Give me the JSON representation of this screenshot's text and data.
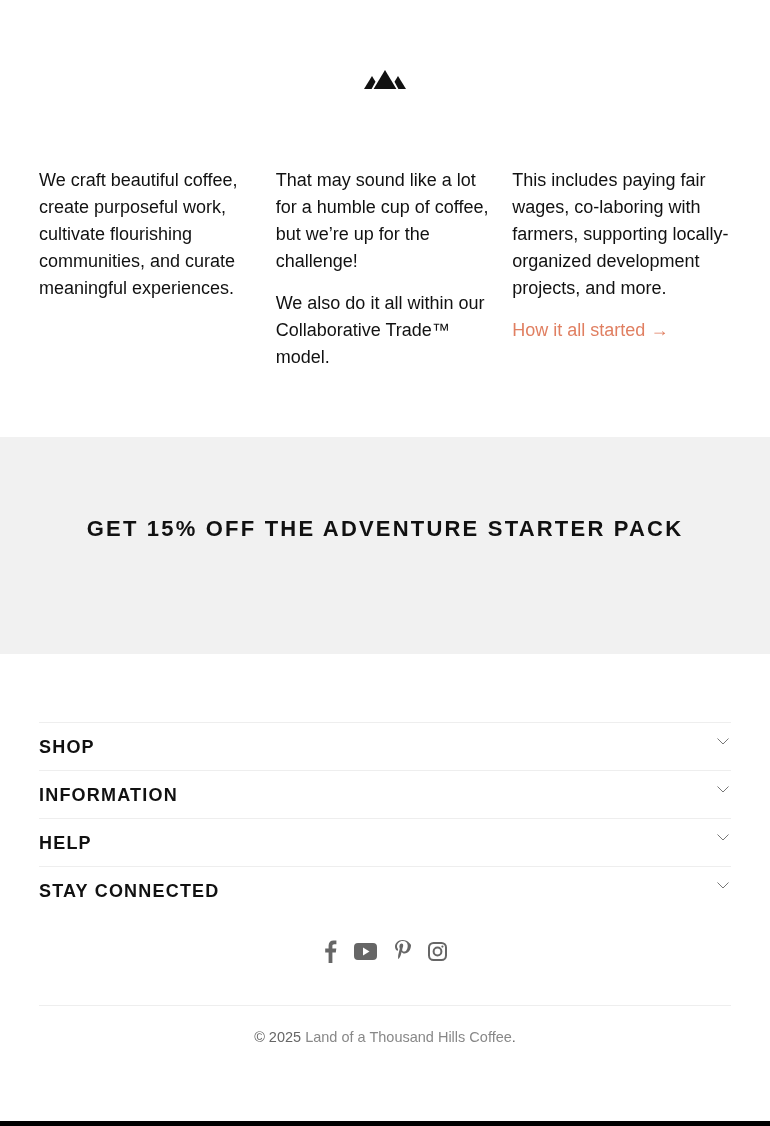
{
  "about": {
    "columns": [
      {
        "paragraphs": [
          "We craft beautiful coffee, create purposeful work, cultivate flourishing communities, and curate meaningful experiences."
        ]
      },
      {
        "paragraphs": [
          "That may sound like a lot for a humble cup of coffee, but we’re up for the challenge!",
          "We also do it all within our Collaborative Trade™ model."
        ]
      },
      {
        "paragraphs": [
          "This includes paying fair wages, co-laboring with farmers, supporting locally-organized development projects, and more."
        ],
        "link": "How it all started →"
      }
    ]
  },
  "promo": {
    "heading": "GET 15% OFF THE ADVENTURE STARTER PACK"
  },
  "footer_menu": [
    {
      "label": "SHOP",
      "expanded": false
    },
    {
      "label": "INFORMATION",
      "expanded": false
    },
    {
      "label": "HELP",
      "expanded": false
    },
    {
      "label": "STAY CONNECTED",
      "expanded": false
    }
  ],
  "copyright": {
    "text": "© 2025",
    "link": "Land of a Thousand Hills Coffee",
    "end": "."
  }
}
